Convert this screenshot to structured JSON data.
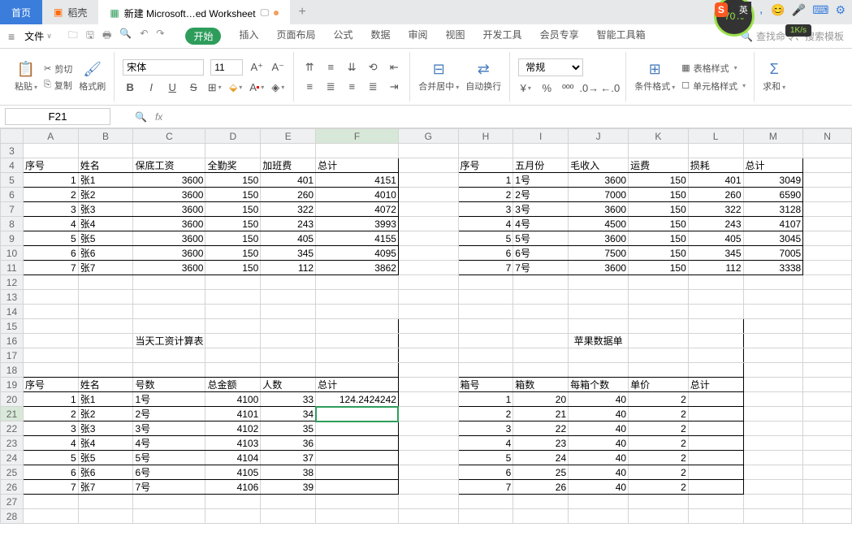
{
  "tabs": {
    "home": "首页",
    "dao": "稻壳",
    "active": "新建 Microsoft…ed Worksheet"
  },
  "ime": {
    "label": "英",
    "speed": "1K/s",
    "percent": "70%"
  },
  "menubar": {
    "file": "文件",
    "tabs": [
      "开始",
      "插入",
      "页面布局",
      "公式",
      "数据",
      "审阅",
      "视图",
      "开发工具",
      "会员专享",
      "智能工具箱"
    ],
    "search_ph": "查找命令、搜索模板"
  },
  "ribbon": {
    "paste": "粘贴",
    "cut": "剪切",
    "copy": "复制",
    "brush": "格式刷",
    "font": "宋体",
    "fontsize": "11",
    "merge": "合并居中",
    "wrap": "自动换行",
    "format_num": "常规",
    "cond": "条件格式",
    "tablestyle": "表格样式",
    "cellstyle": "单元格样式",
    "sum": "求和"
  },
  "refbar": {
    "cell": "F21"
  },
  "cols": [
    "A",
    "B",
    "C",
    "D",
    "E",
    "F",
    "G",
    "H",
    "I",
    "J",
    "K",
    "L",
    "M",
    "N"
  ],
  "table1": {
    "headers": [
      "序号",
      "姓名",
      "保底工资",
      "全勤奖",
      "加班费",
      "总计"
    ],
    "rows": [
      [
        "1",
        "张1",
        "3600",
        "150",
        "401",
        "4151"
      ],
      [
        "2",
        "张2",
        "3600",
        "150",
        "260",
        "4010"
      ],
      [
        "3",
        "张3",
        "3600",
        "150",
        "322",
        "4072"
      ],
      [
        "4",
        "张4",
        "3600",
        "150",
        "243",
        "3993"
      ],
      [
        "5",
        "张5",
        "3600",
        "150",
        "405",
        "4155"
      ],
      [
        "6",
        "张6",
        "3600",
        "150",
        "345",
        "4095"
      ],
      [
        "7",
        "张7",
        "3600",
        "150",
        "112",
        "3862"
      ]
    ]
  },
  "table2": {
    "headers": [
      "序号",
      "五月份",
      "毛收入",
      "运费",
      "损耗",
      "总计"
    ],
    "rows": [
      [
        "1",
        "1号",
        "3600",
        "150",
        "401",
        "3049"
      ],
      [
        "2",
        "2号",
        "7000",
        "150",
        "260",
        "6590"
      ],
      [
        "3",
        "3号",
        "3600",
        "150",
        "322",
        "3128"
      ],
      [
        "4",
        "4号",
        "4500",
        "150",
        "243",
        "4107"
      ],
      [
        "5",
        "5号",
        "3600",
        "150",
        "405",
        "3045"
      ],
      [
        "6",
        "6号",
        "7500",
        "150",
        "345",
        "7005"
      ],
      [
        "7",
        "7号",
        "3600",
        "150",
        "112",
        "3338"
      ]
    ]
  },
  "title1": "当天工资计算表",
  "title2": "苹果数据单",
  "table3": {
    "headers": [
      "序号",
      "姓名",
      "号数",
      "总金额",
      "人数",
      "总计"
    ],
    "rows": [
      [
        "1",
        "张1",
        "1号",
        "4100",
        "33",
        "124.2424242"
      ],
      [
        "2",
        "张2",
        "2号",
        "4101",
        "34",
        ""
      ],
      [
        "3",
        "张3",
        "3号",
        "4102",
        "35",
        ""
      ],
      [
        "4",
        "张4",
        "4号",
        "4103",
        "36",
        ""
      ],
      [
        "5",
        "张5",
        "5号",
        "4104",
        "37",
        ""
      ],
      [
        "6",
        "张6",
        "6号",
        "4105",
        "38",
        ""
      ],
      [
        "7",
        "张7",
        "7号",
        "4106",
        "39",
        ""
      ]
    ]
  },
  "table4": {
    "headers": [
      "箱号",
      "箱数",
      "每箱个数",
      "单价",
      "总计"
    ],
    "rows": [
      [
        "1",
        "20",
        "40",
        "2",
        ""
      ],
      [
        "2",
        "21",
        "40",
        "2",
        ""
      ],
      [
        "3",
        "22",
        "40",
        "2",
        ""
      ],
      [
        "4",
        "23",
        "40",
        "2",
        ""
      ],
      [
        "5",
        "24",
        "40",
        "2",
        ""
      ],
      [
        "6",
        "25",
        "40",
        "2",
        ""
      ],
      [
        "7",
        "26",
        "40",
        "2",
        ""
      ]
    ]
  }
}
